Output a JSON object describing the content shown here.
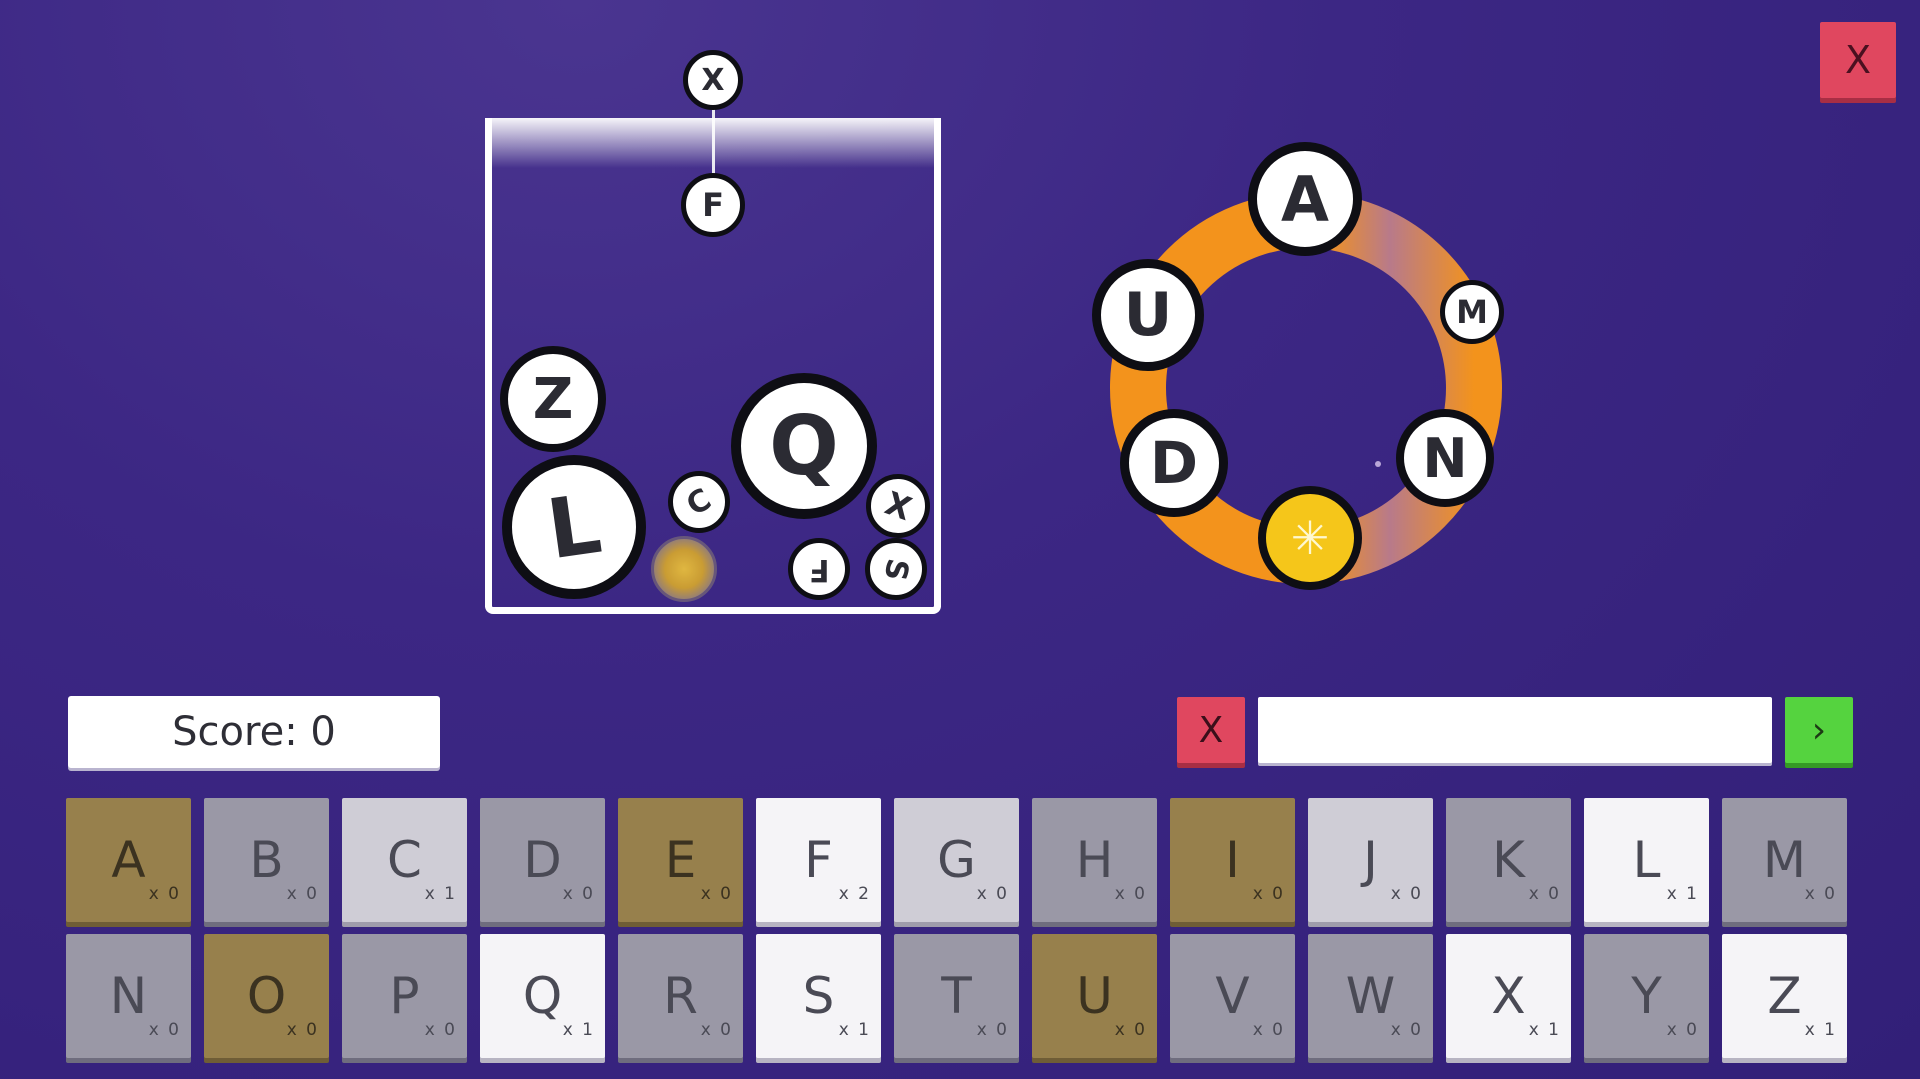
{
  "top_bar": {
    "close_label": "X"
  },
  "jar": {
    "hanging_top_label": "X",
    "hanging_bottom_label": "F",
    "balls": [
      {
        "id": "z",
        "label": "Z"
      },
      {
        "id": "l",
        "label": "L"
      },
      {
        "id": "q",
        "label": "Q"
      },
      {
        "id": "c",
        "label": "C"
      },
      {
        "id": "x",
        "label": "X"
      },
      {
        "id": "f",
        "label": "F"
      },
      {
        "id": "s",
        "label": "S"
      }
    ]
  },
  "ring": {
    "letters": [
      {
        "id": "a",
        "label": "A"
      },
      {
        "id": "u",
        "label": "U"
      },
      {
        "id": "m",
        "label": "M"
      },
      {
        "id": "d",
        "label": "D"
      },
      {
        "id": "n",
        "label": "N"
      }
    ],
    "center_icon": "sparkle-icon",
    "colors": {
      "ring": "#f3931c",
      "ring_fade": "#b87a8a",
      "sun": "#f5c61a"
    }
  },
  "score": {
    "text": "Score: 0"
  },
  "controls": {
    "clear_label": "X",
    "submit_label": "›",
    "input_value": ""
  },
  "keyboard": {
    "keys": [
      {
        "letter": "A",
        "count": "x 0",
        "style": "gold"
      },
      {
        "letter": "B",
        "count": "x 0",
        "style": "gray"
      },
      {
        "letter": "C",
        "count": "x 1",
        "style": "light"
      },
      {
        "letter": "D",
        "count": "x 0",
        "style": "gray"
      },
      {
        "letter": "E",
        "count": "x 0",
        "style": "gold"
      },
      {
        "letter": "F",
        "count": "x 2",
        "style": "white"
      },
      {
        "letter": "G",
        "count": "x 0",
        "style": "light"
      },
      {
        "letter": "H",
        "count": "x 0",
        "style": "gray"
      },
      {
        "letter": "I",
        "count": "x 0",
        "style": "gold"
      },
      {
        "letter": "J",
        "count": "x 0",
        "style": "light"
      },
      {
        "letter": "K",
        "count": "x 0",
        "style": "gray"
      },
      {
        "letter": "L",
        "count": "x 1",
        "style": "white"
      },
      {
        "letter": "M",
        "count": "x 0",
        "style": "gray"
      },
      {
        "letter": "N",
        "count": "x 0",
        "style": "gray"
      },
      {
        "letter": "O",
        "count": "x 0",
        "style": "gold"
      },
      {
        "letter": "P",
        "count": "x 0",
        "style": "gray"
      },
      {
        "letter": "Q",
        "count": "x 1",
        "style": "white"
      },
      {
        "letter": "R",
        "count": "x 0",
        "style": "gray"
      },
      {
        "letter": "S",
        "count": "x 1",
        "style": "white"
      },
      {
        "letter": "T",
        "count": "x 0",
        "style": "gray"
      },
      {
        "letter": "U",
        "count": "x 0",
        "style": "gold"
      },
      {
        "letter": "V",
        "count": "x 0",
        "style": "gray"
      },
      {
        "letter": "W",
        "count": "x 0",
        "style": "gray"
      },
      {
        "letter": "X",
        "count": "x 1",
        "style": "white"
      },
      {
        "letter": "Y",
        "count": "x 0",
        "style": "gray"
      },
      {
        "letter": "Z",
        "count": "x 1",
        "style": "white"
      }
    ]
  }
}
